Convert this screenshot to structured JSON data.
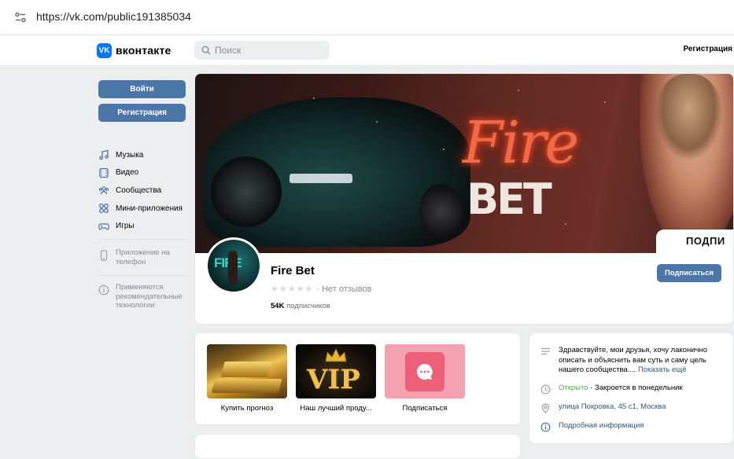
{
  "browser": {
    "url": "https://vk.com/public191385034"
  },
  "header": {
    "logo_mark": "VK",
    "logo_text": "вконтакте",
    "search_placeholder": "Поиск",
    "register_link": "Регистрация"
  },
  "sidebar": {
    "login_label": "Войти",
    "register_label": "Регистрация",
    "items": [
      {
        "label": "Музыка",
        "icon": "music-icon"
      },
      {
        "label": "Видео",
        "icon": "video-icon"
      },
      {
        "label": "Сообщества",
        "icon": "communities-icon"
      },
      {
        "label": "Мини-приложения",
        "icon": "mini-apps-icon"
      },
      {
        "label": "Игры",
        "icon": "games-icon"
      }
    ],
    "app_note": "Приложение на телефон",
    "rec_note": "Применяются рекомендательные технологии"
  },
  "cover": {
    "title_fire": "Fire",
    "title_bet": "BET",
    "badge_text": "ПОДПИ"
  },
  "profile": {
    "name": "Fire Bet",
    "avatar_text": "FIRE",
    "rating_text": "· Нет отзывов",
    "subscribers_count": "54K",
    "subscribers_label": "подписчиков",
    "subscribe_label": "Подписаться"
  },
  "products": [
    {
      "caption": "Купить прогноз",
      "icon": "gold-bars-image"
    },
    {
      "caption": "Наш лучший проду...",
      "icon": "vip-crown-image",
      "image_text": "VIP"
    },
    {
      "caption": "Подписаться",
      "icon": "chat-bubble-icon"
    }
  ],
  "info": {
    "description": "Здравствуйте, мои друзья, хочу лаконично описать и объяснить вам суть и саму цель нашего сообщества....",
    "show_all": "Показать ещё",
    "status_open": "Открыто",
    "status_close": "· Закроется в понедельник",
    "address": "улица Покровка, 45 с1, Москва",
    "details": "Подробная информация"
  },
  "colors": {
    "vk_blue": "#4a76a8",
    "link": "#2a5885",
    "background": "#edeef0",
    "open_green": "#4bb34b"
  }
}
